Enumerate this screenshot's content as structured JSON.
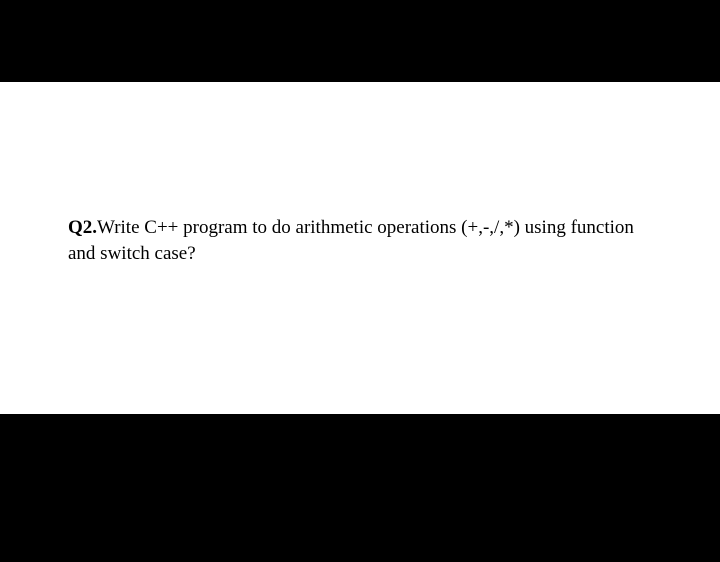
{
  "question": {
    "label": "Q2.",
    "text_line1": "Write C++ program to do arithmetic operations (+,-,/,*) using function",
    "text_line2": "and switch case?"
  }
}
